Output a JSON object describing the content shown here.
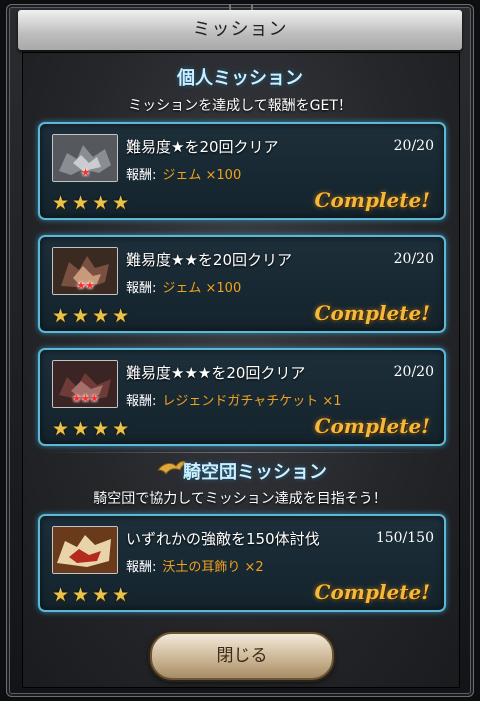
{
  "window": {
    "title": "ミッション"
  },
  "personal": {
    "heading": "個人ミッション",
    "description": "ミッションを達成して報酬をGET！",
    "missions": [
      {
        "title": "難易度★を20回クリア",
        "progress": "20/20",
        "reward_label": "報酬:",
        "reward_value": "ジェム ×100",
        "thumb_stars": "★",
        "rating": "★★★★",
        "status": "Complete!"
      },
      {
        "title": "難易度★★を20回クリア",
        "progress": "20/20",
        "reward_label": "報酬:",
        "reward_value": "ジェム ×100",
        "thumb_stars": "★★",
        "rating": "★★★★",
        "status": "Complete!"
      },
      {
        "title": "難易度★★★を20回クリア",
        "progress": "20/20",
        "reward_label": "報酬:",
        "reward_value": "レジェンドガチャチケット ×1",
        "thumb_stars": "★★★",
        "rating": "★★★★",
        "status": "Complete!"
      }
    ]
  },
  "crew": {
    "heading": "騎空団ミッション",
    "description": "騎空団で協力してミッション達成を目指そう！",
    "missions": [
      {
        "title": "いずれかの強敵を150体討伐",
        "progress": "150/150",
        "reward_label": "報酬:",
        "reward_value": "沃土の耳飾り ×2",
        "rating": "★★★★",
        "status": "Complete!"
      }
    ]
  },
  "footer": {
    "close_label": "閉じる"
  },
  "colors": {
    "accent_border": "#5fb7d6",
    "reward_text": "#f0a21d",
    "complete_text": "#f2b93c",
    "star": "#e9c24a"
  }
}
